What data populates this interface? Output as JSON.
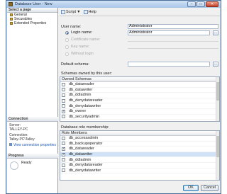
{
  "window": {
    "title": "Database User - New",
    "min": "–",
    "max": "□",
    "close": "✕"
  },
  "left": {
    "select_header": "Select a page",
    "pages": [
      {
        "label": "General"
      },
      {
        "label": "Securables"
      },
      {
        "label": "Extended Properties"
      }
    ],
    "connection_header": "Connection",
    "server_label": "Server:",
    "server_value": "TALLEY-PC",
    "connection_label": "Connection:",
    "connection_value": "Talley-PC\\Talley",
    "view_link": "View connection properties",
    "progress_header": "Progress",
    "progress_status": "Ready"
  },
  "toolbar": {
    "script": "Script",
    "script_arrow": "▼",
    "help": "Help"
  },
  "form": {
    "username_label": "User name:",
    "username_value": "Administrator",
    "login_name_label": "Login name:",
    "login_name_value": "Administrator",
    "certificate_label": "Certificate name:",
    "key_label": "Key name:",
    "without_login_label": "Without login",
    "default_schema_label": "Default schema:",
    "browse": "...",
    "schemas_label": "Schemas owned by this user:",
    "schemas_header": "Owned Schemas",
    "schemas": [
      {
        "name": "db_datareader",
        "checked": false
      },
      {
        "name": "db_datawriter",
        "checked": false
      },
      {
        "name": "db_ddladmin",
        "checked": false
      },
      {
        "name": "db_denydatareader",
        "checked": false
      },
      {
        "name": "db_denydatawriter",
        "checked": false
      },
      {
        "name": "db_owner",
        "checked": true
      },
      {
        "name": "db_securityadmin",
        "checked": false
      }
    ],
    "roles_label": "Database role membership:",
    "roles_header": "Role Members",
    "roles": [
      {
        "name": "db_accessadmin",
        "checked": false
      },
      {
        "name": "db_backupoperator",
        "checked": false
      },
      {
        "name": "db_datareader",
        "checked": true
      },
      {
        "name": "db_datawriter",
        "checked": true,
        "selected": true
      },
      {
        "name": "db_ddladmin",
        "checked": false
      },
      {
        "name": "db_denydatareader",
        "checked": false
      },
      {
        "name": "db_denydatawriter",
        "checked": false
      }
    ]
  },
  "buttons": {
    "ok": "OK",
    "cancel": "Cancel"
  },
  "colors": {
    "accent": "#2a4f8e",
    "selection": "#cfe2f6"
  }
}
